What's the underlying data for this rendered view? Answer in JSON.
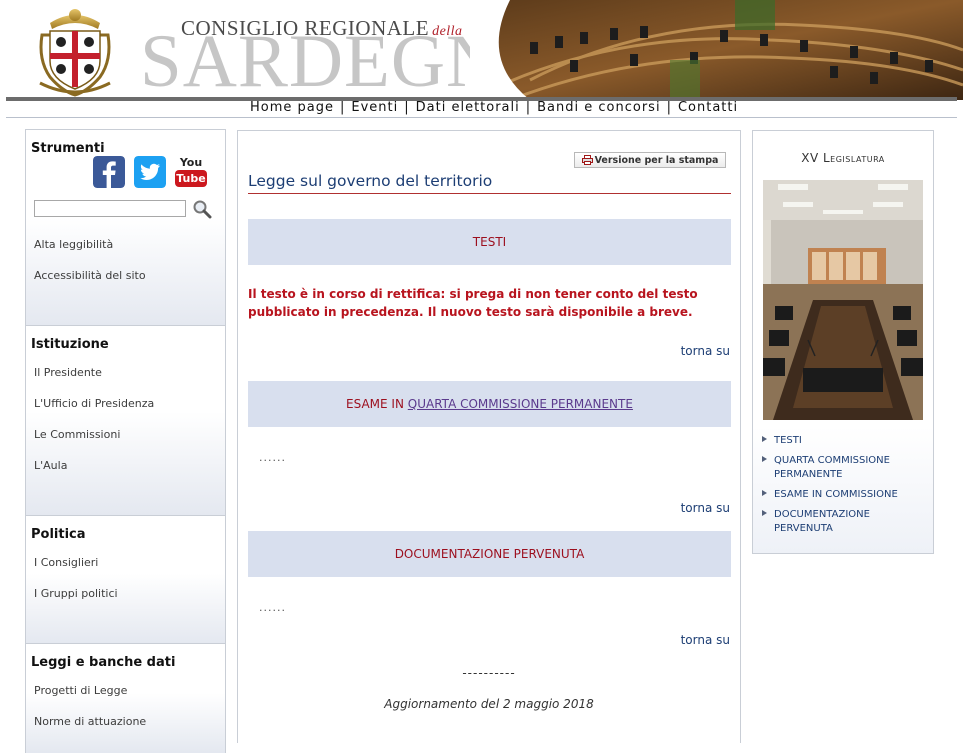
{
  "header": {
    "title_line1": "CONSIGLIO REGIONALE",
    "title_della": "della",
    "title_line2": "SARDEGNA"
  },
  "nav": [
    {
      "label": "Home page"
    },
    {
      "label": "Eventi"
    },
    {
      "label": "Dati elettorali"
    },
    {
      "label": "Bandi e concorsi"
    },
    {
      "label": "Contatti"
    }
  ],
  "sidebar": {
    "strumenti": {
      "title": "Strumenti",
      "social": [
        {
          "icon": "facebook-icon",
          "color": "#3b5998"
        },
        {
          "icon": "twitter-icon",
          "color": "#1da1f2"
        },
        {
          "icon": "youtube-icon",
          "label_top": "You",
          "label_bottom": "Tube",
          "color": "#cc181e"
        }
      ],
      "search_placeholder": "",
      "links": [
        "Alta leggibilità",
        "Accessibilità del sito"
      ]
    },
    "istituzione": {
      "title": "Istituzione",
      "links": [
        "Il Presidente",
        "L'Ufficio di Presidenza",
        "Le Commissioni",
        "L'Aula"
      ]
    },
    "politica": {
      "title": "Politica",
      "links": [
        "I Consiglieri",
        "I Gruppi politici"
      ]
    },
    "leggi": {
      "title": "Leggi e banche dati",
      "links": [
        "Progetti di Legge",
        "Norme di attuazione"
      ]
    }
  },
  "main": {
    "print_label": "Versione per la stampa",
    "page_title": "Legge sul governo del territorio",
    "sections": [
      {
        "heading": "TESTI"
      },
      {
        "heading_prefix": "ESAME IN",
        "heading_link": "QUARTA COMMISSIONE PERMANENTE"
      },
      {
        "heading": "DOCUMENTAZIONE PERVENUTA"
      }
    ],
    "notice": "Il testo è in corso di rettifica: si prega di non tener conto del testo pubblicato in precedenza. Il nuovo testo sarà disponibile a breve.",
    "back_to_top": "torna su",
    "placeholder_dots": "......",
    "separator": "----------",
    "updated": "Aggiornamento del 2 maggio 2018"
  },
  "right": {
    "title": "XV Legislatura",
    "links": [
      {
        "label": "TESTI"
      },
      {
        "label": "QUARTA COMMISSIONE PERMANENTE"
      },
      {
        "label": "ESAME IN COMMISSIONE"
      },
      {
        "label": "DOCUMENTAZIONE PERVENUTA"
      }
    ]
  },
  "colors": {
    "accent_red": "#9c0f1e",
    "band_blue": "#d8dfee",
    "title_blue": "#1d3e74",
    "nav_rule": "#6c6c6c"
  }
}
